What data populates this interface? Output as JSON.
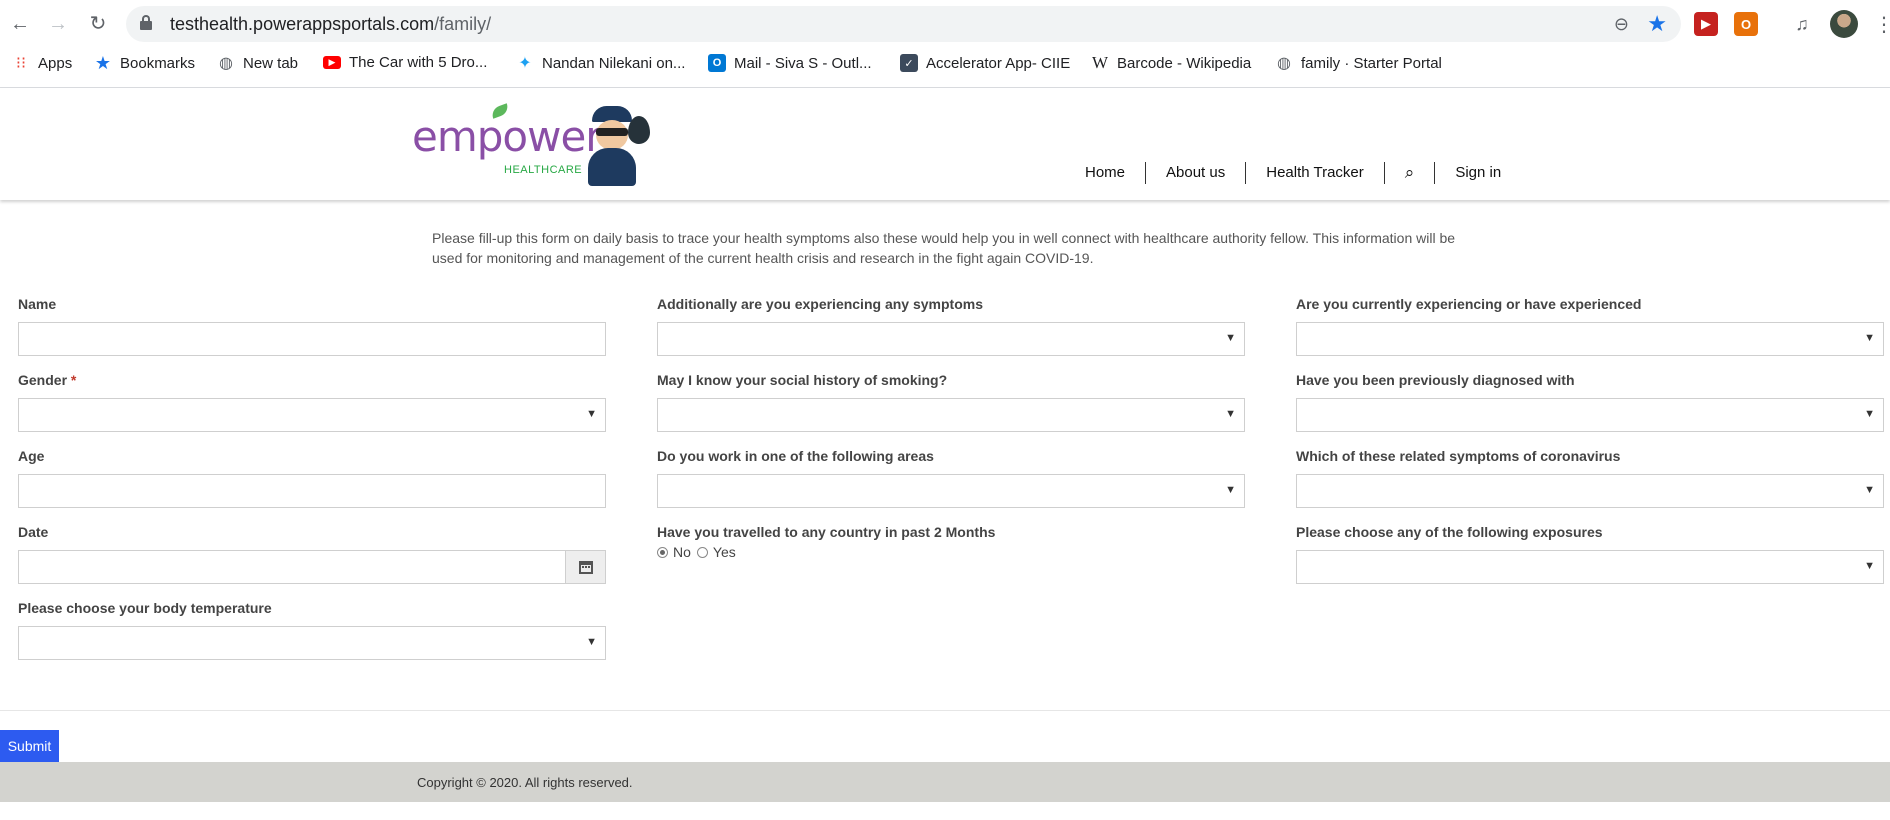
{
  "browser": {
    "url_host": "testhealth.powerappsportals.com",
    "url_path": "/family/",
    "bookmarks": [
      {
        "label": "Apps",
        "icon": "apps-grid-icon"
      },
      {
        "label": "Bookmarks",
        "icon": "star-icon"
      },
      {
        "label": "New tab",
        "icon": "globe-icon"
      },
      {
        "label": "The Car with 5 Dro...",
        "icon": "youtube-icon"
      },
      {
        "label": "Nandan Nilekani on...",
        "icon": "twitter-icon"
      },
      {
        "label": "Mail - Siva S - Outl...",
        "icon": "outlook-icon"
      },
      {
        "label": "Accelerator App- CIIE",
        "icon": "app-icon"
      },
      {
        "label": "Barcode - Wikipedia",
        "icon": "wikipedia-icon"
      },
      {
        "label": "family · Starter Portal",
        "icon": "globe-icon"
      }
    ]
  },
  "header": {
    "logo_word": "empower",
    "logo_sub": "HEALTHCARE",
    "nav": [
      "Home",
      "About us",
      "Health Tracker",
      "Sign in"
    ]
  },
  "intro": "Please fill-up this form on daily basis to trace your health symptoms also these would help you in well connect with healthcare authority fellow. This information will be used for monitoring and management of the current health crisis and research in the fight again COVID-19.",
  "form": {
    "col1": {
      "name": "Name",
      "gender": "Gender",
      "required_mark": "*",
      "age": "Age",
      "date": "Date",
      "temperature": "Please choose your body temperature"
    },
    "col2": {
      "symptoms": "Additionally are you experiencing any symptoms",
      "smoking": "May I know your social history of smoking?",
      "work_areas": "Do you work in one of the following areas",
      "travelled": "Have you travelled to any country in past 2 Months",
      "travel_options": [
        "No",
        "Yes"
      ],
      "travel_selected": "No"
    },
    "col3": {
      "experiencing": "Are you currently experiencing or have experienced",
      "diagnosed": "Have you been previously diagnosed with",
      "related_symptoms": "Which of these related symptoms of coronavirus",
      "exposures": "Please choose any of the following exposures"
    },
    "submit": "Submit"
  },
  "footer": {
    "copyright": "Copyright © 2020. All rights reserved."
  },
  "colors": {
    "accent": "#2d5bf0",
    "logo_purple": "#8a4fa6",
    "logo_green": "#27a844",
    "footer_bg": "#d3d3cf"
  }
}
